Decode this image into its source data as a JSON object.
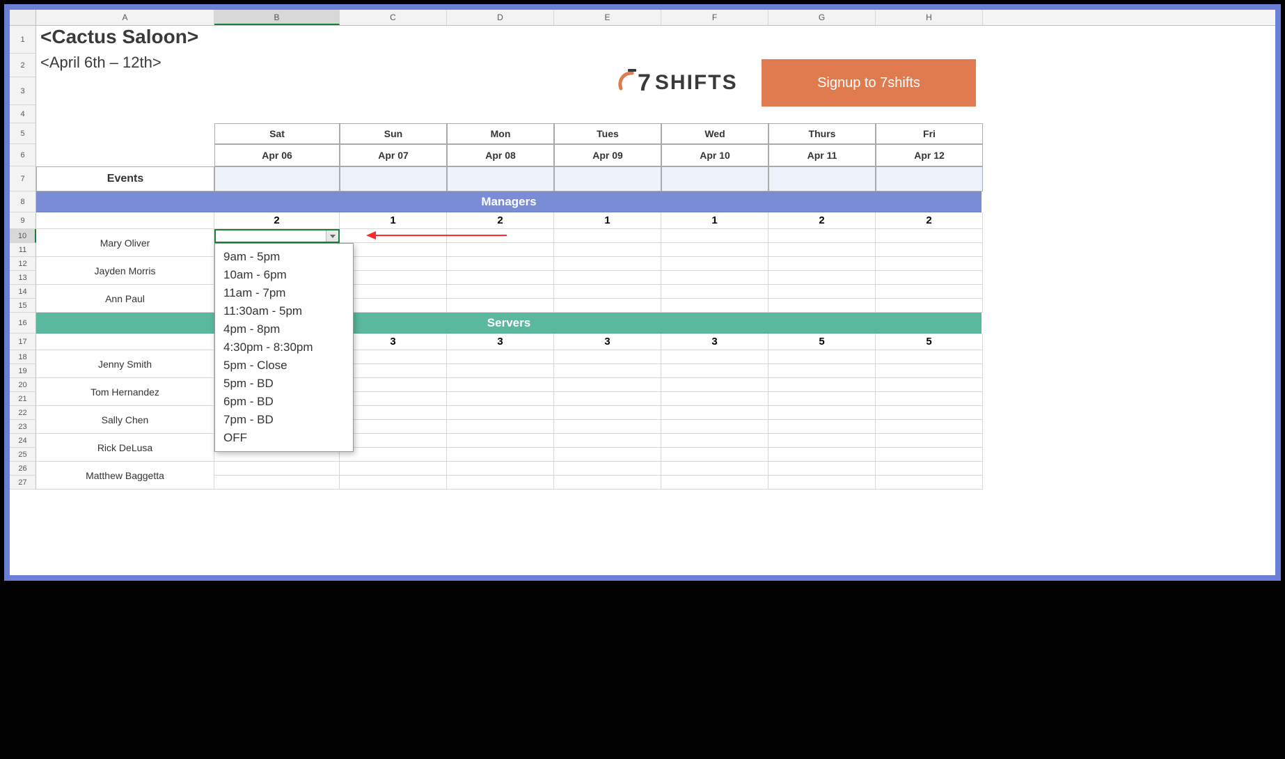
{
  "columns": [
    "A",
    "B",
    "C",
    "D",
    "E",
    "F",
    "G",
    "H"
  ],
  "title": "<Cactus Saloon>",
  "subtitle": "<April 6th – 12th>",
  "logo_text": "SHIFTS",
  "logo_seven": "7",
  "signup_label": "Signup to 7shifts",
  "days": [
    "Sat",
    "Sun",
    "Mon",
    "Tues",
    "Wed",
    "Thurs",
    "Fri"
  ],
  "dates": [
    "Apr 06",
    "Apr 07",
    "Apr 08",
    "Apr 09",
    "Apr 10",
    "Apr 11",
    "Apr 12"
  ],
  "events_label": "Events",
  "sections": {
    "managers": {
      "label": "Managers",
      "counts": [
        "2",
        "1",
        "2",
        "1",
        "1",
        "2",
        "2"
      ],
      "staff": [
        "Mary Oliver",
        "Jayden Morris",
        "Ann Paul"
      ]
    },
    "servers": {
      "label": "Servers",
      "counts": [
        "",
        "3",
        "3",
        "3",
        "3",
        "5",
        "5"
      ],
      "staff": [
        "Jenny Smith",
        "Tom Hernandez",
        "Sally Chen",
        "Rick DeLusa",
        "Matthew Baggetta"
      ]
    }
  },
  "dropdown_options": [
    "9am - 5pm",
    "10am - 6pm",
    "11am - 7pm",
    "11:30am - 5pm",
    "4pm - 8pm",
    "4:30pm - 8:30pm",
    "5pm - Close",
    "5pm - BD",
    "6pm - BD",
    "7pm - BD",
    "OFF"
  ],
  "selected_cell": "B10",
  "row_numbers": [
    1,
    2,
    3,
    4,
    5,
    6,
    7,
    8,
    9,
    10,
    11,
    12,
    13,
    14,
    15,
    16,
    17,
    18,
    19,
    20,
    21,
    22,
    23,
    24,
    25,
    26,
    27
  ]
}
